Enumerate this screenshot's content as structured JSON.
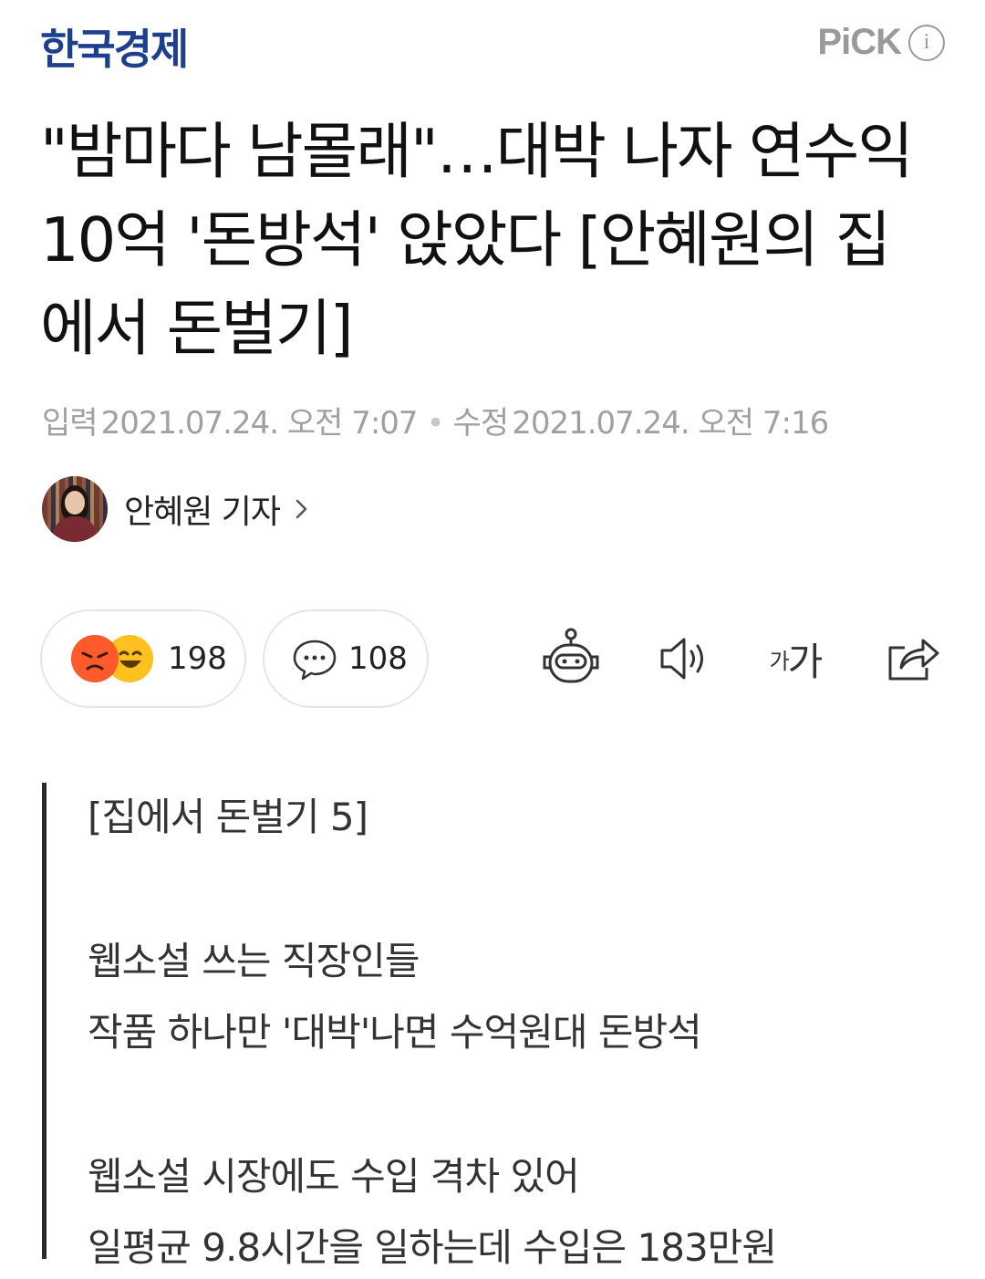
{
  "header": {
    "press_name": "한국경제",
    "pick_label": "PiCK",
    "pick_info": "i"
  },
  "article": {
    "headline": "\"밤마다 남몰래\"…대박 나자 연수익 10억 '돈방석' 앉았다 [안혜원의 집에서 돈벌기]",
    "input_label": "입력",
    "input_datetime": "2021.07.24. 오전 7:07",
    "modified_label": "수정",
    "modified_datetime": "2021.07.24. 오전 7:16",
    "reporter": "안혜원 기자"
  },
  "actions": {
    "reaction_count": "198",
    "comment_count": "108",
    "font_size_small": "가",
    "font_size_big": "가"
  },
  "summary": {
    "tag": "[집에서 돈벌기 5]",
    "lines": [
      "웹소설 쓰는 직장인들",
      "작품 하나만 '대박'나면 수억원대 돈방석",
      "웹소설 시장에도 수입 격차 있어",
      "일평균 9.8시간을 일하는데 수입은 183만원"
    ]
  },
  "colors": {
    "press_logo": "#1d3f8e",
    "pick": "#9a9a9a",
    "meta_text": "#a0a0a0",
    "angry_emoji": "#ff5a2b",
    "laugh_emoji": "#ffc11f"
  }
}
